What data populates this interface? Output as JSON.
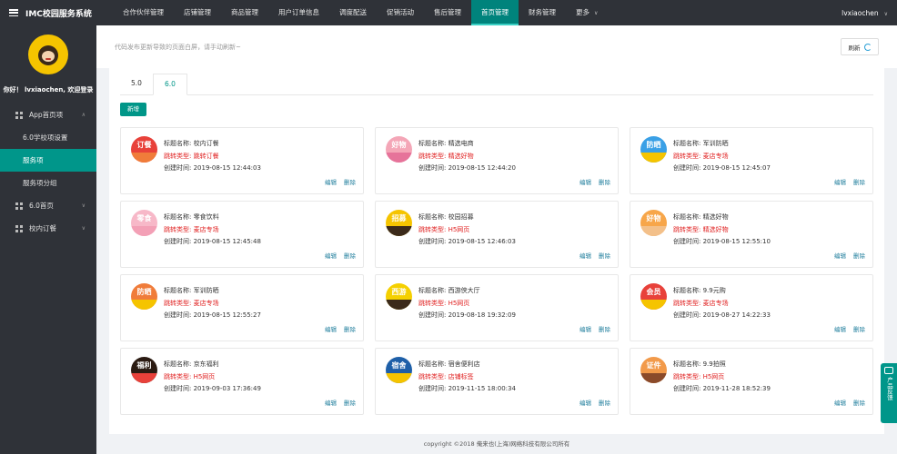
{
  "app": {
    "title": "IMC校园服务系统"
  },
  "nav": {
    "items": [
      {
        "label": "合作伙伴管理",
        "active": false
      },
      {
        "label": "店铺管理",
        "active": false
      },
      {
        "label": "商品管理",
        "active": false
      },
      {
        "label": "用户订单信息",
        "active": false
      },
      {
        "label": "调度配送",
        "active": false
      },
      {
        "label": "促销活动",
        "active": false
      },
      {
        "label": "售后管理",
        "active": false
      },
      {
        "label": "首页管理",
        "active": true
      },
      {
        "label": "财务管理",
        "active": false
      },
      {
        "label": "更多",
        "active": false
      }
    ],
    "user": "lvxiaochen"
  },
  "sidebar": {
    "greeting": "你好！ lvxiaochen, 欢迎登录",
    "menu": {
      "app_home": "App首页项",
      "sub_school": "6.0学校项设置",
      "sub_service": "服务项",
      "sub_group": "服务项分组",
      "home6": "6.0首页",
      "campus_order": "校内订餐"
    }
  },
  "notice": {
    "text": "代码发布更新导致的页面白屏，请手动刷新~",
    "refresh_label": "刷新"
  },
  "tabs": [
    {
      "label": "5.0",
      "active": true
    },
    {
      "label": "6.0",
      "active": false
    }
  ],
  "add_label": "新增",
  "labels": {
    "title": "标题名称:",
    "type": "跳转类型:",
    "time": "创建时间:",
    "edit": "编辑",
    "delete": "删除"
  },
  "cards": [
    {
      "title": "校内订餐",
      "type": "跳转订餐",
      "time": "2019-08-15 12:44:03",
      "icon": "订餐",
      "color": "#e8413a",
      "ribbon": "#f07c3a"
    },
    {
      "title": "精选电商",
      "type": "精选好物",
      "time": "2019-08-15 12:44:20",
      "icon": "好物",
      "color": "#f4a6b7",
      "ribbon": "#e6739a"
    },
    {
      "title": "军训防晒",
      "type": "麦店专场",
      "time": "2019-08-15 12:45:07",
      "icon": "防晒",
      "color": "#3aa0e6",
      "ribbon": "#f5c400"
    },
    {
      "title": "零食饮料",
      "type": "麦店专场",
      "time": "2019-08-15 12:45:48",
      "icon": "零食",
      "color": "#f7b8c8",
      "ribbon": "#f3a0b6"
    },
    {
      "title": "校园招募",
      "type": "H5网页",
      "time": "2019-08-15 12:46:03",
      "icon": "招募",
      "color": "#f5c400",
      "ribbon": "#3b2a1a"
    },
    {
      "title": "精选好物",
      "type": "精选好物",
      "time": "2019-08-15 12:55:10",
      "icon": "好物",
      "color": "#f7a64a",
      "ribbon": "#f3c08a"
    },
    {
      "title": "军训防晒",
      "type": "麦店专场",
      "time": "2019-08-15 12:55:27",
      "icon": "防晒",
      "color": "#f07c3a",
      "ribbon": "#f5c400"
    },
    {
      "title": "西游侠大厅",
      "type": "H5网页",
      "time": "2019-08-18 19:32:09",
      "icon": "西游",
      "color": "#f5d000",
      "ribbon": "#3b2a1a"
    },
    {
      "title": "9.9元购",
      "type": "麦店专场",
      "time": "2019-08-27 14:22:33",
      "icon": "会员",
      "color": "#e8413a",
      "ribbon": "#f5c400"
    },
    {
      "title": "京东福利",
      "type": "H5网页",
      "time": "2019-09-03 17:36:49",
      "icon": "福利",
      "color": "#2b1b12",
      "ribbon": "#e8413a"
    },
    {
      "title": "宿舍便利店",
      "type": "店铺标签",
      "time": "2019-11-15 18:00:34",
      "icon": "宿舍",
      "color": "#1e5fa8",
      "ribbon": "#f5c400"
    },
    {
      "title": "9.9拍照",
      "type": "H5网页",
      "time": "2019-11-28 18:52:39",
      "icon": "证件",
      "color": "#f29a4a",
      "ribbon": "#8a4a2a"
    }
  ],
  "footer": "copyright ©2018 俺来也(上海)网络科技有限公司所有",
  "feedback": {
    "label": "产品反馈"
  }
}
